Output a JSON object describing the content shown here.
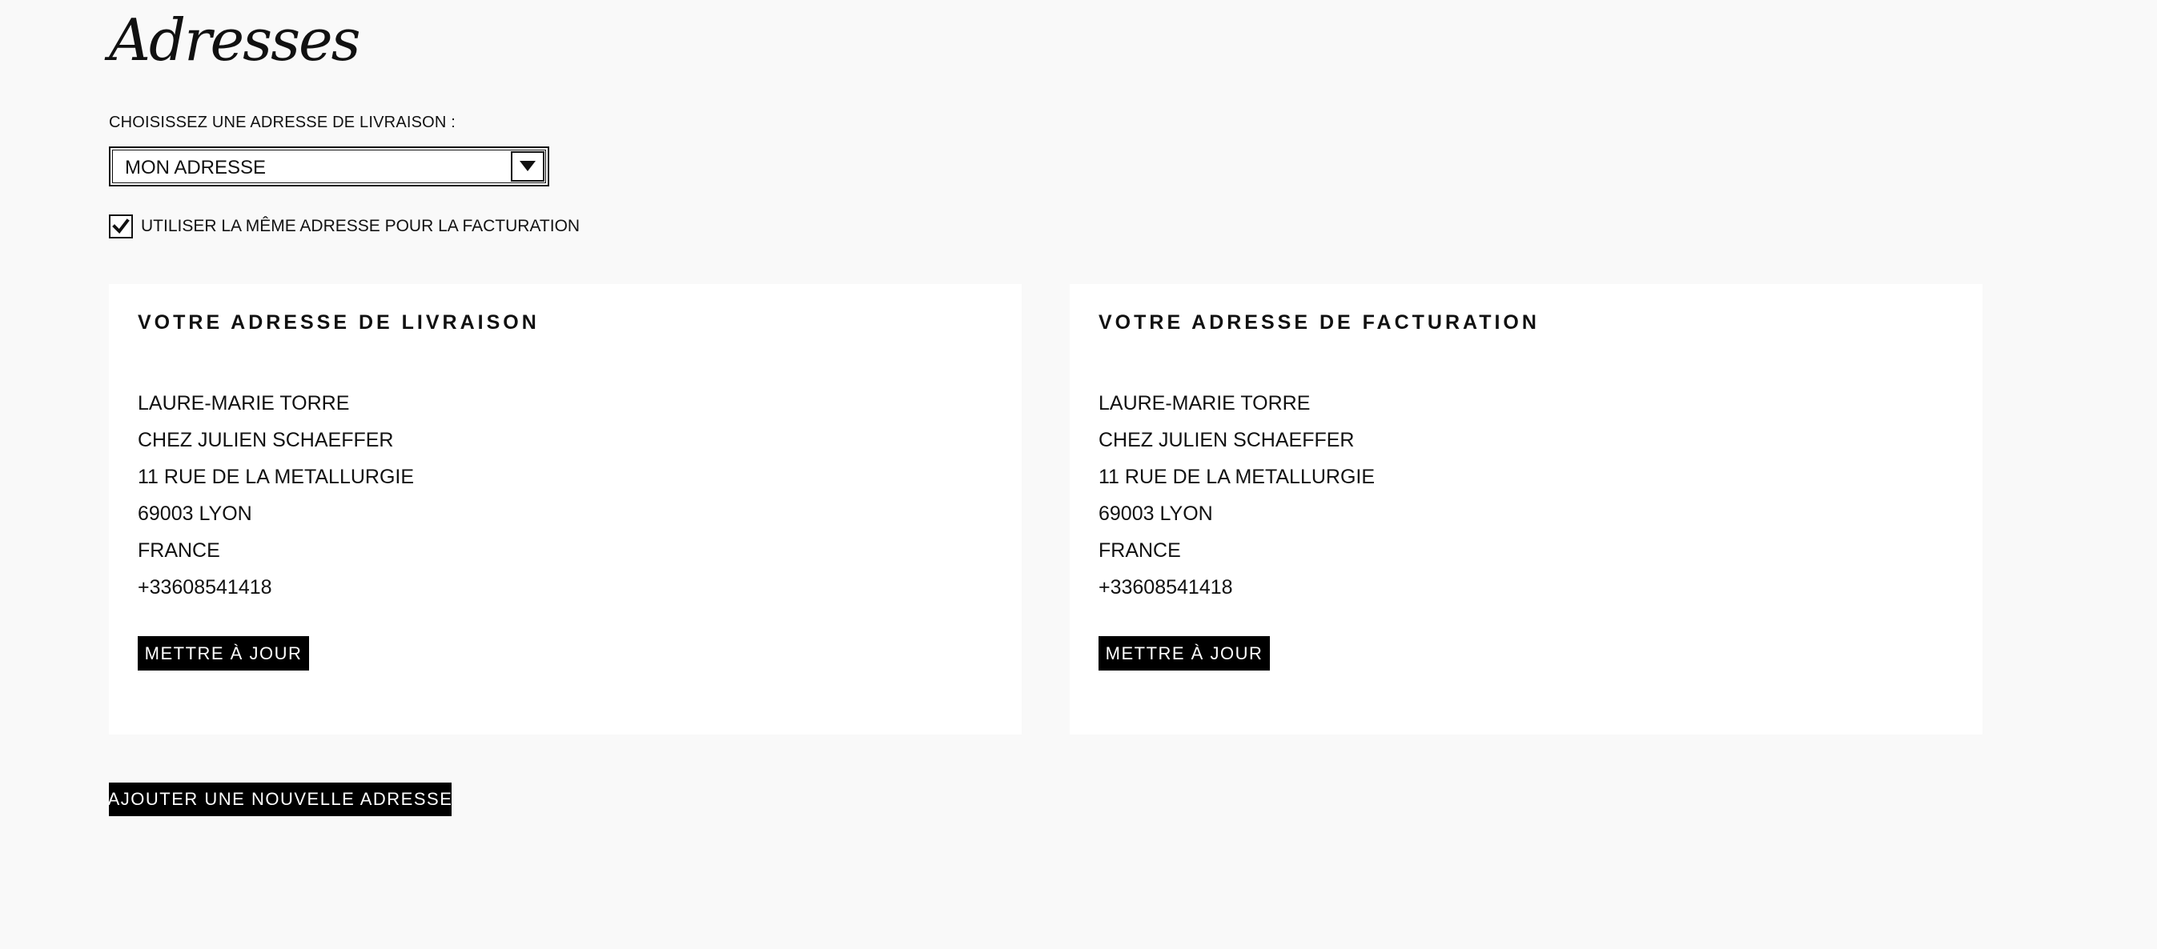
{
  "page": {
    "title": "Adresses"
  },
  "delivery_select": {
    "label": "CHOISISSEZ UNE ADRESSE DE LIVRAISON :",
    "value": "MON ADRESSE"
  },
  "same_billing": {
    "label": "UTILISER LA MÊME ADRESSE POUR LA FACTURATION",
    "checked": true
  },
  "shipping_card": {
    "title": "VOTRE ADRESSE DE LIVRAISON",
    "lines": [
      "LAURE-MARIE TORRE",
      "CHEZ JULIEN SCHAEFFER",
      "11 RUE DE LA METALLURGIE",
      "69003 LYON",
      "FRANCE",
      "+33608541418"
    ],
    "button": "METTRE À JOUR"
  },
  "billing_card": {
    "title": "VOTRE ADRESSE DE FACTURATION",
    "lines": [
      "LAURE-MARIE TORRE",
      "CHEZ JULIEN SCHAEFFER",
      "11 RUE DE LA METALLURGIE",
      "69003 LYON",
      "FRANCE",
      "+33608541418"
    ],
    "button": "METTRE À JOUR"
  },
  "add_address_button": "AJOUTER UNE NOUVELLE ADRESSE",
  "icons": {
    "select_arrow": "caret-down-icon",
    "checkbox_mark": "checkmark-icon"
  }
}
